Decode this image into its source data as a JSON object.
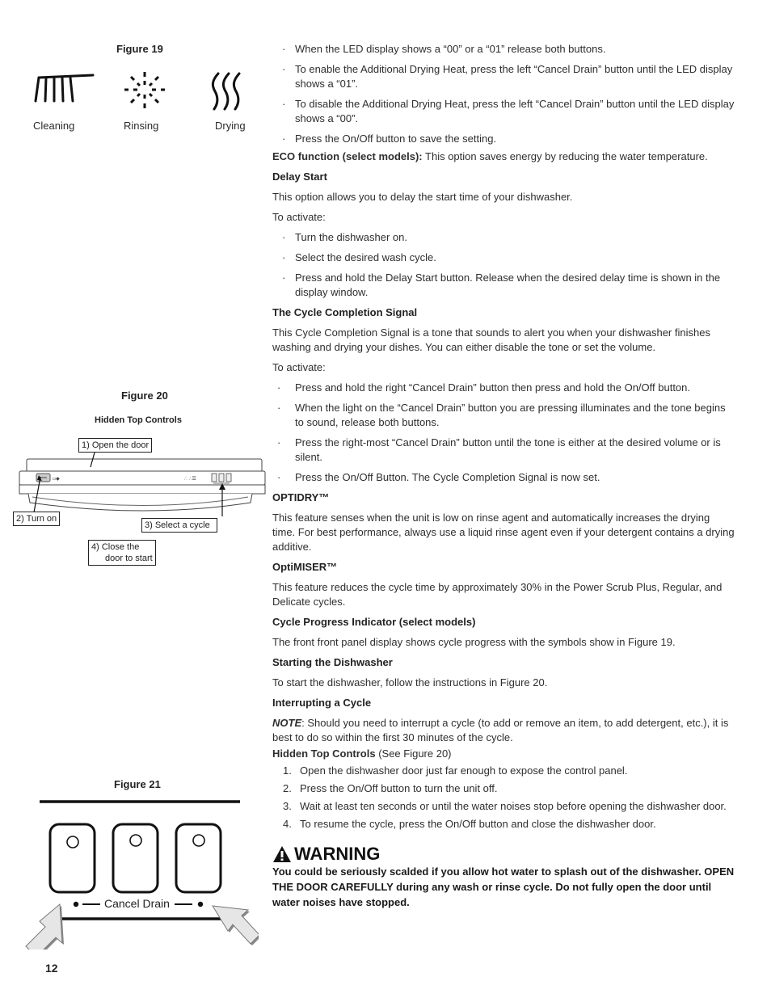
{
  "page_number": "12",
  "figure19": {
    "caption": "Figure 19",
    "icons": [
      {
        "name": "cleaning-brush-icon",
        "label": "Cleaning"
      },
      {
        "name": "rinsing-sparkle-icon",
        "label": "Rinsing"
      },
      {
        "name": "drying-waves-icon",
        "label": "Drying"
      }
    ]
  },
  "figure20": {
    "caption": "Figure 20",
    "subtitle": "Hidden Top Controls",
    "callouts": {
      "open_door": "1) Open the door",
      "turn_on": "2) Turn on",
      "select_cycle": "3) Select a cycle",
      "close_line1": "4) Close the",
      "close_line2": "door to start"
    }
  },
  "figure21": {
    "caption": "Figure 21",
    "cancel_drain_label": "Cancel Drain"
  },
  "content": {
    "bullets_top": [
      "When the LED display shows a “00” or a “01” release both buttons.",
      "To enable the Additional Drying Heat, press the left “Cancel Drain” button until the LED display shows a “01”.",
      "To disable the Additional Drying Heat, press the left “Cancel Drain” button until the LED display shows a “00”.",
      "Press the On/Off button to save the setting."
    ],
    "eco": {
      "label": "ECO function (select models):",
      "text": " This option saves energy by reducing the water temperature."
    },
    "delay_start": {
      "heading": "Delay Start",
      "intro": "This option allows you to delay the start time of your dishwasher.",
      "activate": "To activate:",
      "bullets": [
        "Turn the dishwasher on.",
        "Select the desired wash cycle.",
        "Press and hold the Delay Start button. Release when the desired delay time is shown in the display window."
      ]
    },
    "completion_signal": {
      "heading": "The Cycle Completion Signal",
      "intro": "This Cycle Completion Signal is a tone that sounds to alert you when your dishwasher finishes washing and drying your dishes. You can either disable the tone or set the volume.",
      "activate": "To activate:",
      "bullets": [
        "Press and hold the right “Cancel Drain” button then press and hold the On/Off button.",
        "When the light on the “Cancel Drain” button you are pressing illuminates and the tone begins to sound, release both buttons.",
        "Press the right-most “Cancel Drain” button until the tone is either at the desired volume or is silent.",
        "Press the On/Off Button. The Cycle Completion Signal is now set."
      ]
    },
    "optidry": {
      "heading": "OPTIDRY™",
      "text": "This feature senses when the unit is low on rinse agent and automatically increases the drying time. For best performance, always use a liquid rinse agent even if your detergent contains a drying additive."
    },
    "optimiser": {
      "heading": "OptiMISER™",
      "text": "This feature reduces the cycle time by approximately 30% in the Power Scrub Plus, Regular, and Delicate cycles."
    },
    "progress_indicator": {
      "heading": "Cycle Progress Indicator (select models)",
      "text": "The front front panel display shows cycle progress with the symbols show in Figure 19."
    },
    "starting": {
      "heading": "Starting the Dishwasher",
      "text": "To start the dishwasher, follow the instructions in Figure 20."
    },
    "interrupting": {
      "heading": "Interrupting a Cycle",
      "note_label": "NOTE",
      "note_text": ": Should you need to interrupt a cycle (to add or remove an item, to add detergent, etc.), it is best to do so within the first 30 minutes of the cycle."
    },
    "hidden_top": {
      "heading": "Hidden Top Controls",
      "ref": " (See Figure 20)",
      "steps": [
        {
          "n": "1.",
          "text": "Open the dishwasher door just far enough to expose the control panel."
        },
        {
          "n": "2.",
          "text": "Press the On/Off button to turn the unit off."
        },
        {
          "n": "3.",
          "text": "Wait at least ten seconds or until the water noises stop before opening the dishwasher door."
        },
        {
          "n": "4.",
          "text": "To resume the cycle, press the On/Off button and close the dishwasher door."
        }
      ]
    },
    "warning": {
      "title": "WARNING",
      "body": "You could be seriously scalded if you allow hot water to splash out of the dishwasher. OPEN THE DOOR CAREFULLY during any wash or rinse cycle. Do not fully open the door until water noises have stopped."
    }
  }
}
